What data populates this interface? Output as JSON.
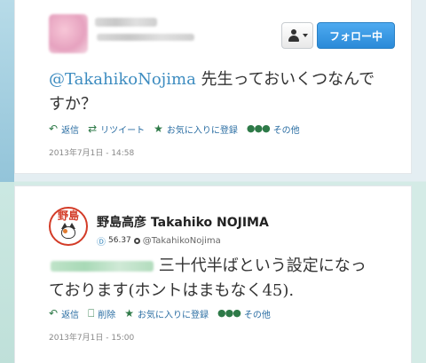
{
  "tweet1": {
    "follow_label": "フォロー中",
    "mention": "@TakahikoNojima",
    "text_line1_rest": " 先生っておいくつなんで",
    "text_line2": "すか？",
    "actions": {
      "reply": "返信",
      "retweet": "リツイート",
      "favorite": "お気に入りに登録",
      "more": "その他"
    },
    "timestamp": "2013年7月1日 - 14:58"
  },
  "tweet2": {
    "avatar_text": "野島",
    "display_name": "野島高彦 Takahiko NOJIMA",
    "klout_score": "56.37",
    "handle": "@TakahikoNojima",
    "text_line1_rest": " 三十代半ばという設定になっ",
    "text_line2": "ております(ホントはまもなく45).",
    "actions": {
      "reply": "返信",
      "delete": "削除",
      "favorite": "お気に入りに登録",
      "more": "その他"
    },
    "timestamp": "2013年7月1日 - 15:00"
  },
  "icons": [
    "user-icon",
    "caret-down-icon",
    "reply-icon",
    "retweet-icon",
    "star-icon",
    "more-dots-icon",
    "trash-icon",
    "klout-icon",
    "settings-icon"
  ],
  "colors": {
    "follow_button": "#2a8ad8",
    "mention_link": "#3d8cc0",
    "action_icon": "#2e7a48",
    "action_text": "#2b6ea3"
  }
}
